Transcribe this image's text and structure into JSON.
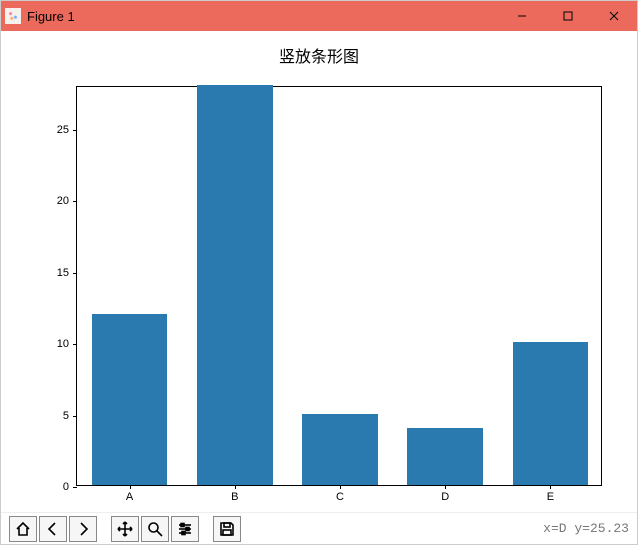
{
  "window": {
    "title": "Figure 1",
    "buttons": {
      "minimize": "–",
      "maximize": "□",
      "close": "✕"
    }
  },
  "chart_data": {
    "type": "bar",
    "title": "竖放条形图",
    "categories": [
      "A",
      "B",
      "C",
      "D",
      "E"
    ],
    "values": [
      12,
      28,
      5,
      4,
      10
    ],
    "xlabel": "",
    "ylabel": "",
    "ylim": [
      0,
      28
    ],
    "yticks": [
      0,
      5,
      10,
      15,
      20,
      25
    ],
    "bar_color": "#2a7ab0"
  },
  "toolbar": {
    "home": "home-icon",
    "back": "back-icon",
    "forward": "forward-icon",
    "pan": "pan-icon",
    "zoom": "zoom-icon",
    "configure": "configure-icon",
    "save": "save-icon"
  },
  "status": {
    "coord_text": "x=D y=25.23"
  }
}
